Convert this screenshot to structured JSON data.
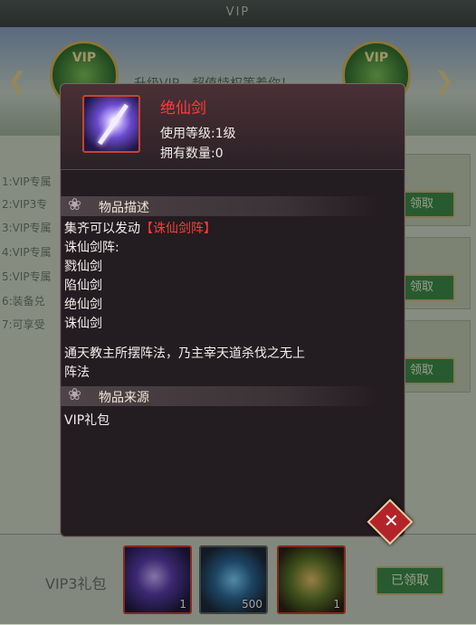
{
  "window": {
    "title": "VIP"
  },
  "background": {
    "header_partial": "升级VIP，超值特权等着你！",
    "vip_level_left": "VIP",
    "vip_level_right": "VIP",
    "privileges": [
      "1:VIP专属",
      "2:VIP3专",
      "3:VIP专属",
      "4:VIP专属",
      "5:VIP专属",
      "6:装备兑",
      "7:可享受"
    ],
    "claim_label": "领取",
    "package_name": "VIP3礼包",
    "rewards": [
      {
        "name": "绝仙剑",
        "count": "1"
      },
      {
        "name": "vortex-item",
        "count": "500"
      },
      {
        "name": "treasure-chest",
        "count": "1"
      }
    ],
    "claimed_label": "已领取"
  },
  "popup": {
    "item_name": "绝仙剑",
    "use_level": "使用等级:1级",
    "owned": "拥有数量:0",
    "section_desc": "物品描述",
    "desc_prefix": "集齐可以发动",
    "desc_highlight": "【诛仙剑阵】",
    "desc_lines": [
      "诛仙剑阵:",
      "戮仙剑",
      "陷仙剑",
      "绝仙剑",
      "诛仙剑"
    ],
    "desc_para_1": "通天教主所摆阵法，乃主宰天道杀伐之无上",
    "desc_para_2": "阵法",
    "section_source": "物品来源",
    "source": "VIP礼包",
    "close_icon": "close-icon"
  },
  "colors": {
    "item_name": "#ff3b3b",
    "claim_green": "#3e8a49",
    "close_red": "#b3242a"
  }
}
